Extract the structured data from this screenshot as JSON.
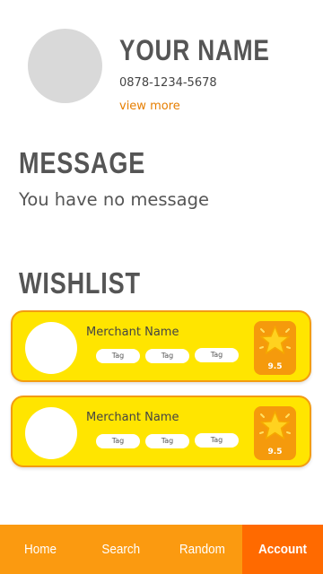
{
  "profile": {
    "name": "YOUR NAME",
    "phone": "0878-1234-5678",
    "view_more": "view more"
  },
  "message": {
    "title": "MESSAGE",
    "text": "You have no message"
  },
  "wishlist": {
    "title": "WISHLIST",
    "items": [
      {
        "merchant": "Merchant Name",
        "tags": [
          "Tag",
          "Tag",
          "Tag"
        ],
        "rating": "9.5",
        "icon": "star-icon"
      },
      {
        "merchant": "Merchant Name",
        "tags": [
          "Tag",
          "Tag",
          "Tag"
        ],
        "rating": "9.5",
        "icon": "star-icon"
      }
    ]
  },
  "nav": {
    "items": [
      "Home",
      "Search",
      "Random",
      "Account"
    ],
    "active": "Account"
  },
  "colors": {
    "accent": "#fb9a10",
    "active_tab": "#ff6a00",
    "card": "#ffe500",
    "card_border": "#f39c12",
    "link": "#e67e00"
  }
}
